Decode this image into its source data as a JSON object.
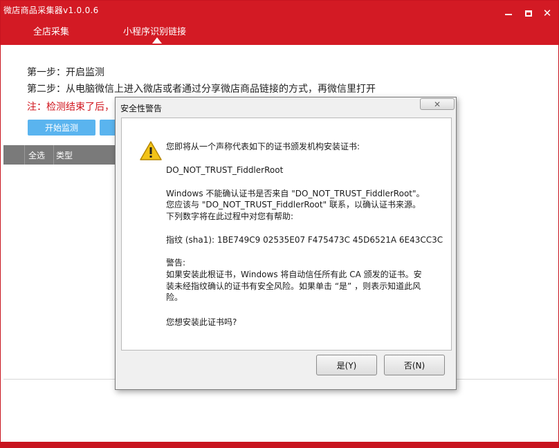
{
  "window": {
    "title": "微店商品采集器v1.0.0.6",
    "tabs": [
      {
        "label": "全店采集"
      },
      {
        "label": "小程序识别链接"
      }
    ]
  },
  "main": {
    "step1": "第一步：开启监测",
    "step2": "第二步：从电脑微信上进入微店或者通过分享微店商品链接的方式，再微信里打开",
    "note": "注：检测结束了后，",
    "start_button": "开始监测",
    "table": {
      "columns": [
        "全选",
        "类型"
      ]
    }
  },
  "dialog": {
    "title": "安全性警告",
    "lines": [
      "您即将从一个声称代表如下的证书颁发机构安装证书:",
      "DO_NOT_TRUST_FiddlerRoot",
      "Windows 不能确认证书是否来自 \"DO_NOT_TRUST_FiddlerRoot\"。",
      "您应该与 \"DO_NOT_TRUST_FiddlerRoot\" 联系，以确认证书来源。",
      "下列数字将在此过程中对您有帮助:",
      "指纹 (sha1): 1BE749C9 02535E07 F475473C 45D6521A 6E43CC3C",
      "警告:",
      "如果安装此根证书，Windows 将自动信任所有此 CA 颁发的证书。安",
      "装未经指纹确认的证书有安全风险。如果单击 “是” ，则表示知道此风",
      "险。",
      "您想安装此证书吗?"
    ],
    "yes_button": "是(Y)",
    "no_button": "否(N)"
  },
  "colors": {
    "brand_red": "#d31a24",
    "accent_blue": "#5ab4ef",
    "note_red": "#d0141c"
  },
  "icons": [
    "minimize-icon",
    "maximize-icon",
    "close-icon",
    "warning-icon"
  ]
}
